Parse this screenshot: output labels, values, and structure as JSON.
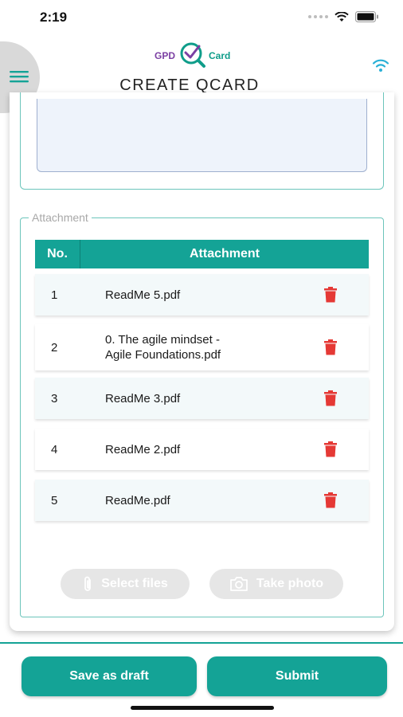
{
  "status_bar": {
    "time": "2:19"
  },
  "header": {
    "logo": {
      "left": "GPD",
      "right": "Card"
    },
    "title": "CREATE QCARD",
    "menu_icon": "hamburger-icon",
    "wifi_icon": "wifi-icon"
  },
  "attachment": {
    "legend": "Attachment",
    "columns": {
      "no": "No.",
      "attachment": "Attachment"
    },
    "rows": [
      {
        "no": "1",
        "line1": "ReadMe 5.pdf",
        "line2": ""
      },
      {
        "no": "2",
        "line1": "0. The agile mindset -",
        "line2": "Agile Foundations.pdf"
      },
      {
        "no": "3",
        "line1": "ReadMe 3.pdf",
        "line2": ""
      },
      {
        "no": "4",
        "line1": "ReadMe 2.pdf",
        "line2": ""
      },
      {
        "no": "5",
        "line1": "ReadMe.pdf",
        "line2": ""
      }
    ],
    "select_files_label": "Select files",
    "take_photo_label": "Take photo"
  },
  "footer": {
    "save_draft_label": "Save as draft",
    "submit_label": "Submit"
  },
  "colors": {
    "accent": "#14a396",
    "delete": "#e53935",
    "logo_purple": "#7b3fa3"
  }
}
